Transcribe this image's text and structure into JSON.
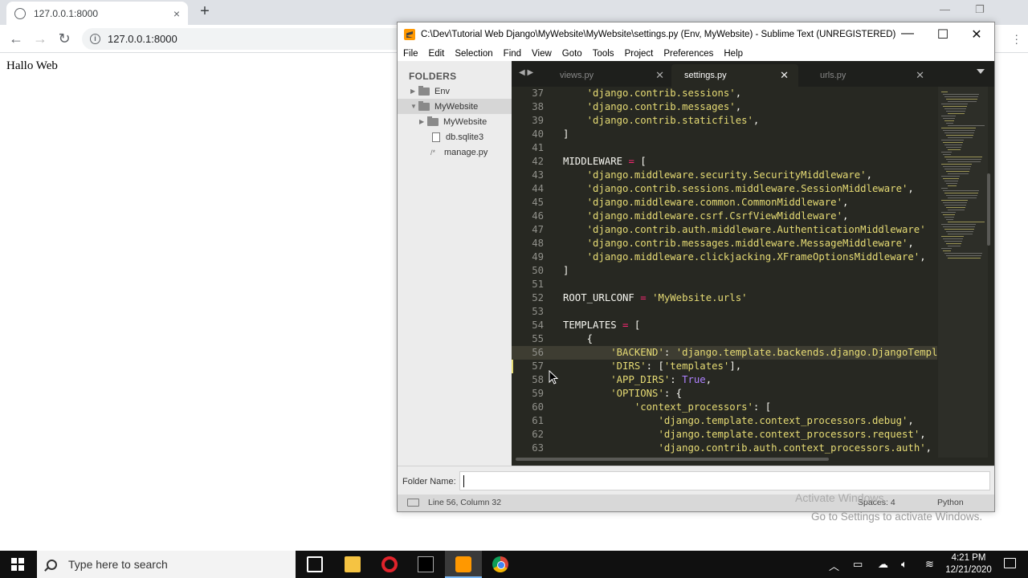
{
  "browser": {
    "tab_title": "127.0.0.1:8000",
    "tab_close": "×",
    "new_tab": "+",
    "url": "127.0.0.1:8000",
    "page_text": "Hallo Web"
  },
  "sublime": {
    "title": "C:\\Dev\\Tutorial Web Django\\MyWebsite\\MyWebsite\\settings.py (Env, MyWebsite) - Sublime Text (UNREGISTERED)",
    "menu": [
      "File",
      "Edit",
      "Selection",
      "Find",
      "View",
      "Goto",
      "Tools",
      "Project",
      "Preferences",
      "Help"
    ],
    "sidebar": {
      "header": "FOLDERS",
      "items": [
        {
          "label": "Env",
          "type": "folder",
          "expanded": false
        },
        {
          "label": "MyWebsite",
          "type": "folder",
          "expanded": true,
          "selected": true
        },
        {
          "label": "MyWebsite",
          "type": "folder",
          "expanded": false
        },
        {
          "label": "db.sqlite3",
          "type": "file"
        },
        {
          "label": "manage.py",
          "type": "code"
        }
      ]
    },
    "tabs": [
      {
        "label": "views.py",
        "active": false
      },
      {
        "label": "settings.py",
        "active": true
      },
      {
        "label": "urls.py",
        "active": false
      }
    ],
    "code": [
      {
        "n": "37",
        "t": [
          [
            "    ",
            ""
          ],
          [
            "'django.contrib.sessions'",
            "s"
          ],
          [
            ",",
            ""
          ]
        ]
      },
      {
        "n": "38",
        "t": [
          [
            "    ",
            ""
          ],
          [
            "'django.contrib.messages'",
            "s"
          ],
          [
            ",",
            ""
          ]
        ]
      },
      {
        "n": "39",
        "t": [
          [
            "    ",
            ""
          ],
          [
            "'django.contrib.staticfiles'",
            "s"
          ],
          [
            ",",
            ""
          ]
        ]
      },
      {
        "n": "40",
        "t": [
          [
            "]",
            ""
          ]
        ]
      },
      {
        "n": "41",
        "t": []
      },
      {
        "n": "42",
        "t": [
          [
            "MIDDLEWARE ",
            ""
          ],
          [
            "=",
            "k"
          ],
          [
            " [",
            ""
          ]
        ]
      },
      {
        "n": "43",
        "t": [
          [
            "    ",
            ""
          ],
          [
            "'django.middleware.security.SecurityMiddleware'",
            "s"
          ],
          [
            ",",
            ""
          ]
        ]
      },
      {
        "n": "44",
        "t": [
          [
            "    ",
            ""
          ],
          [
            "'django.contrib.sessions.middleware.SessionMiddleware'",
            "s"
          ],
          [
            ",",
            ""
          ]
        ]
      },
      {
        "n": "45",
        "t": [
          [
            "    ",
            ""
          ],
          [
            "'django.middleware.common.CommonMiddleware'",
            "s"
          ],
          [
            ",",
            ""
          ]
        ]
      },
      {
        "n": "46",
        "t": [
          [
            "    ",
            ""
          ],
          [
            "'django.middleware.csrf.CsrfViewMiddleware'",
            "s"
          ],
          [
            ",",
            ""
          ]
        ]
      },
      {
        "n": "47",
        "t": [
          [
            "    ",
            ""
          ],
          [
            "'django.contrib.auth.middleware.AuthenticationMiddleware'",
            "s"
          ]
        ]
      },
      {
        "n": "48",
        "t": [
          [
            "    ",
            ""
          ],
          [
            "'django.contrib.messages.middleware.MessageMiddleware'",
            "s"
          ],
          [
            ",",
            ""
          ]
        ]
      },
      {
        "n": "49",
        "t": [
          [
            "    ",
            ""
          ],
          [
            "'django.middleware.clickjacking.XFrameOptionsMiddleware'",
            "s"
          ],
          [
            ",",
            ""
          ]
        ]
      },
      {
        "n": "50",
        "t": [
          [
            "]",
            ""
          ]
        ]
      },
      {
        "n": "51",
        "t": []
      },
      {
        "n": "52",
        "t": [
          [
            "ROOT_URLCONF ",
            ""
          ],
          [
            "=",
            "k"
          ],
          [
            " ",
            ""
          ],
          [
            "'MyWebsite.urls'",
            "s"
          ]
        ]
      },
      {
        "n": "53",
        "t": []
      },
      {
        "n": "54",
        "t": [
          [
            "TEMPLATES ",
            ""
          ],
          [
            "=",
            "k"
          ],
          [
            " [",
            ""
          ]
        ]
      },
      {
        "n": "55",
        "t": [
          [
            "    {",
            ""
          ]
        ]
      },
      {
        "n": "56",
        "t": [
          [
            "        ",
            ""
          ],
          [
            "'BACKEND'",
            "s"
          ],
          [
            ": ",
            ""
          ],
          [
            "'django.template.backends.django.DjangoTemplates'",
            "s"
          ]
        ]
      },
      {
        "n": "57",
        "t": [
          [
            "        ",
            ""
          ],
          [
            "'DIRS'",
            "s"
          ],
          [
            ": [",
            ""
          ],
          [
            "'templates'",
            "s"
          ],
          [
            "],",
            ""
          ]
        ]
      },
      {
        "n": "58",
        "t": [
          [
            "        ",
            ""
          ],
          [
            "'APP_DIRS'",
            "s"
          ],
          [
            ": ",
            ""
          ],
          [
            "True",
            "c"
          ],
          [
            ",",
            ""
          ]
        ]
      },
      {
        "n": "59",
        "t": [
          [
            "        ",
            ""
          ],
          [
            "'OPTIONS'",
            "s"
          ],
          [
            ": {",
            ""
          ]
        ]
      },
      {
        "n": "60",
        "t": [
          [
            "            ",
            ""
          ],
          [
            "'context_processors'",
            "s"
          ],
          [
            ": [",
            ""
          ]
        ]
      },
      {
        "n": "61",
        "t": [
          [
            "                ",
            ""
          ],
          [
            "'django.template.context_processors.debug'",
            "s"
          ],
          [
            ",",
            ""
          ]
        ]
      },
      {
        "n": "62",
        "t": [
          [
            "                ",
            ""
          ],
          [
            "'django.template.context_processors.request'",
            "s"
          ],
          [
            ",",
            ""
          ]
        ]
      },
      {
        "n": "63",
        "t": [
          [
            "                ",
            ""
          ],
          [
            "'django.contrib.auth.context_processors.auth'",
            "s"
          ],
          [
            ",",
            ""
          ]
        ]
      }
    ],
    "highlight_line": "56",
    "modified_line": "57",
    "input_label": "Folder Name:",
    "input_value": "",
    "status": {
      "position": "Line 56, Column 32",
      "spaces": "Spaces: 4",
      "syntax": "Python"
    }
  },
  "watermark": {
    "line1": "Activate Windows",
    "line2": "Go to Settings to activate Windows."
  },
  "taskbar": {
    "search_placeholder": "Type here to search",
    "time": "4:21 PM",
    "date": "12/21/2020"
  },
  "colors": {
    "editor_bg": "#272822",
    "string": "#e6db74",
    "keyword": "#f92672",
    "constant": "#ae81ff"
  }
}
